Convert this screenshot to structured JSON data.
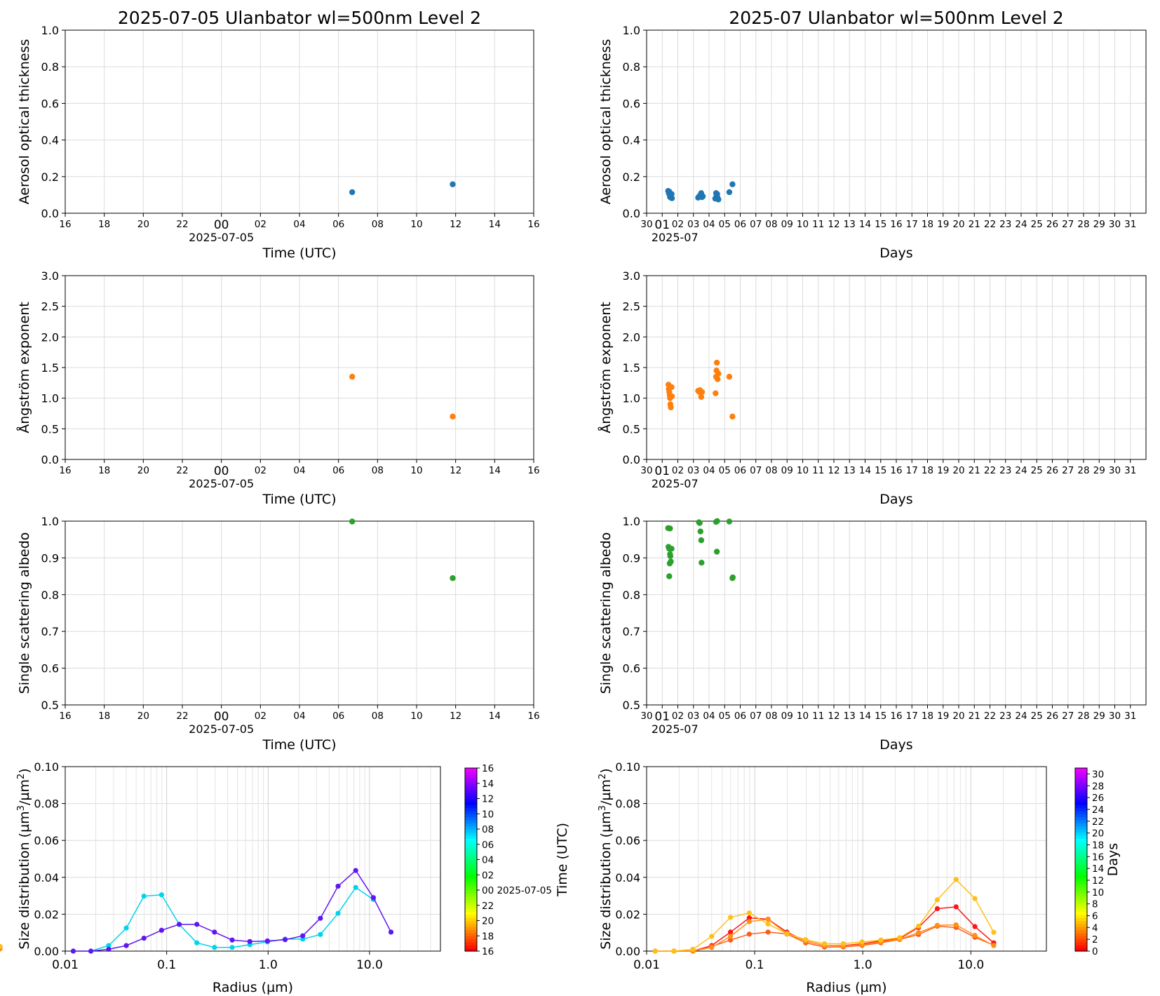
{
  "chart_data": [
    {
      "type": "scatter",
      "title": "2025-07-05  Ulanbator  wl=500nm  Level 2",
      "xlabel": "Time (UTC)",
      "ylabel": "Aerosol optical thickness",
      "date_label": "2025-07-05",
      "x_unit": "hours since 2025-07-05 00:00 UTC",
      "xlim": [
        -8,
        16
      ],
      "ylim": [
        0,
        1
      ],
      "x_ticks": [
        "16",
        "18",
        "20",
        "22",
        "00",
        "02",
        "04",
        "06",
        "08",
        "10",
        "12",
        "14",
        "16"
      ],
      "y_ticks": [
        "0.0",
        "0.2",
        "0.4",
        "0.6",
        "0.8",
        "1.0"
      ],
      "color": "#1f77b4",
      "points": [
        [
          6.7,
          0.115
        ],
        [
          11.85,
          0.158
        ]
      ]
    },
    {
      "type": "scatter",
      "title": "2025-07  Ulanbator  wl=500nm  Level 2",
      "xlabel": "Days",
      "ylabel": "Aerosol optical thickness",
      "date_label": "2025-07",
      "x_unit": "day of July 2025",
      "xlim": [
        0,
        32
      ],
      "ylim": [
        0,
        1
      ],
      "x_ticks": [
        "30",
        "01",
        "02",
        "03",
        "04",
        "05",
        "06",
        "07",
        "08",
        "09",
        "10",
        "11",
        "12",
        "13",
        "14",
        "15",
        "16",
        "17",
        "18",
        "19",
        "20",
        "21",
        "22",
        "23",
        "24",
        "25",
        "26",
        "27",
        "28",
        "29",
        "30",
        "31"
      ],
      "y_ticks": [
        "0.0",
        "0.2",
        "0.4",
        "0.6",
        "0.8",
        "1.0"
      ],
      "color": "#1f77b4",
      "points": [
        [
          1.38,
          0.122
        ],
        [
          1.42,
          0.11
        ],
        [
          1.45,
          0.118
        ],
        [
          1.48,
          0.098
        ],
        [
          1.5,
          0.088
        ],
        [
          1.52,
          0.1
        ],
        [
          1.55,
          0.092
        ],
        [
          1.58,
          0.085
        ],
        [
          1.6,
          0.105
        ],
        [
          1.62,
          0.082
        ],
        [
          3.3,
          0.085
        ],
        [
          3.35,
          0.09
        ],
        [
          3.4,
          0.095
        ],
        [
          3.45,
          0.1
        ],
        [
          3.5,
          0.11
        ],
        [
          3.55,
          0.088
        ],
        [
          3.6,
          0.092
        ],
        [
          4.4,
          0.08
        ],
        [
          4.45,
          0.11
        ],
        [
          4.48,
          0.095
        ],
        [
          4.52,
          0.105
        ],
        [
          4.55,
          0.085
        ],
        [
          4.6,
          0.075
        ],
        [
          5.3,
          0.115
        ],
        [
          5.5,
          0.158
        ]
      ]
    },
    {
      "type": "scatter",
      "xlabel": "Time (UTC)",
      "ylabel": "Ångström exponent",
      "date_label": "2025-07-05",
      "xlim": [
        -8,
        16
      ],
      "ylim": [
        0,
        3
      ],
      "x_ticks": [
        "16",
        "18",
        "20",
        "22",
        "00",
        "02",
        "04",
        "06",
        "08",
        "10",
        "12",
        "14",
        "16"
      ],
      "y_ticks": [
        "0.0",
        "0.5",
        "1.0",
        "1.5",
        "2.0",
        "2.5",
        "3.0"
      ],
      "color": "#ff7f0e",
      "points": [
        [
          6.7,
          1.35
        ],
        [
          11.85,
          0.7
        ]
      ]
    },
    {
      "type": "scatter",
      "xlabel": "Days",
      "ylabel": "Ångström exponent",
      "date_label": "2025-07",
      "xlim": [
        0,
        32
      ],
      "ylim": [
        0,
        3
      ],
      "x_ticks": [
        "30",
        "01",
        "02",
        "03",
        "04",
        "05",
        "06",
        "07",
        "08",
        "09",
        "10",
        "11",
        "12",
        "13",
        "14",
        "15",
        "16",
        "17",
        "18",
        "19",
        "20",
        "21",
        "22",
        "23",
        "24",
        "25",
        "26",
        "27",
        "28",
        "29",
        "30",
        "31"
      ],
      "y_ticks": [
        "0.0",
        "0.5",
        "1.0",
        "1.5",
        "2.0",
        "2.5",
        "3.0"
      ],
      "color": "#ff7f0e",
      "points": [
        [
          1.4,
          1.22
        ],
        [
          1.42,
          1.15
        ],
        [
          1.45,
          1.1
        ],
        [
          1.48,
          1.05
        ],
        [
          1.5,
          1.0
        ],
        [
          1.52,
          0.9
        ],
        [
          1.55,
          0.85
        ],
        [
          1.6,
          1.18
        ],
        [
          1.62,
          1.03
        ],
        [
          3.3,
          1.12
        ],
        [
          3.38,
          1.1
        ],
        [
          3.42,
          1.13
        ],
        [
          3.5,
          1.02
        ],
        [
          3.55,
          1.1
        ],
        [
          4.42,
          1.08
        ],
        [
          4.45,
          1.35
        ],
        [
          4.48,
          1.45
        ],
        [
          4.5,
          1.58
        ],
        [
          4.55,
          1.31
        ],
        [
          4.6,
          1.4
        ],
        [
          5.3,
          1.35
        ],
        [
          5.5,
          0.7
        ]
      ]
    },
    {
      "type": "scatter",
      "xlabel": "Time (UTC)",
      "ylabel": "Single scattering albedo",
      "date_label": "2025-07-05",
      "xlim": [
        -8,
        16
      ],
      "ylim": [
        0.5,
        1.0
      ],
      "x_ticks": [
        "16",
        "18",
        "20",
        "22",
        "00",
        "02",
        "04",
        "06",
        "08",
        "10",
        "12",
        "14",
        "16"
      ],
      "y_ticks": [
        "0.5",
        "0.6",
        "0.7",
        "0.8",
        "0.9",
        "1.0"
      ],
      "color": "#2ca02c",
      "points": [
        [
          6.7,
          0.999
        ],
        [
          11.85,
          0.845
        ]
      ]
    },
    {
      "type": "scatter",
      "xlabel": "Days",
      "ylabel": "Single scattering albedo",
      "date_label": "2025-07",
      "xlim": [
        0,
        32
      ],
      "ylim": [
        0.5,
        1.0
      ],
      "x_ticks": [
        "30",
        "01",
        "02",
        "03",
        "04",
        "05",
        "06",
        "07",
        "08",
        "09",
        "10",
        "11",
        "12",
        "13",
        "14",
        "15",
        "16",
        "17",
        "18",
        "19",
        "20",
        "21",
        "22",
        "23",
        "24",
        "25",
        "26",
        "27",
        "28",
        "29",
        "30",
        "31"
      ],
      "y_ticks": [
        "0.5",
        "0.6",
        "0.7",
        "0.8",
        "0.9",
        "1.0"
      ],
      "color": "#2ca02c",
      "points": [
        [
          1.38,
          0.981
        ],
        [
          1.5,
          0.98
        ],
        [
          1.4,
          0.93
        ],
        [
          1.45,
          0.925
        ],
        [
          1.5,
          0.91
        ],
        [
          1.52,
          0.905
        ],
        [
          1.48,
          0.885
        ],
        [
          1.55,
          0.89
        ],
        [
          1.45,
          0.85
        ],
        [
          1.6,
          0.925
        ],
        [
          3.35,
          0.997
        ],
        [
          3.4,
          0.995
        ],
        [
          3.45,
          0.972
        ],
        [
          3.5,
          0.948
        ],
        [
          3.52,
          0.887
        ],
        [
          4.45,
          0.998
        ],
        [
          4.52,
          1.0
        ],
        [
          4.5,
          0.917
        ],
        [
          5.3,
          0.999
        ],
        [
          5.5,
          0.845
        ],
        [
          5.52,
          0.847
        ]
      ]
    },
    {
      "type": "line",
      "xlabel": "Radius (µm)",
      "ylabel_main": "Size distribution (µm",
      "ylabel_sup1": "3",
      "ylabel_mid": "/µm",
      "ylabel_sup2": "2",
      "ylabel_end": ")",
      "xscale": "log",
      "xlim": [
        0.01,
        50
      ],
      "ylim": [
        0,
        0.1
      ],
      "x_ticks": [
        "0.01",
        "0.1",
        "1.0",
        "10.0"
      ],
      "y_ticks": [
        "0.00",
        "0.02",
        "0.04",
        "0.06",
        "0.08",
        "0.10"
      ],
      "radius": [
        0.012,
        0.0179,
        0.0268,
        0.04,
        0.0597,
        0.0891,
        0.133,
        0.1985,
        0.2963,
        0.4423,
        0.6603,
        0.9856,
        1.4713,
        2.1963,
        3.2785,
        4.8939,
        7.3053,
        10.9048,
        16.2778
      ],
      "series": [
        {
          "time_utc": 6.7,
          "color": "#00d4ec",
          "values": [
            0.0,
            0.0,
            0.003,
            0.0125,
            0.0298,
            0.0305,
            0.0145,
            0.0045,
            0.002,
            0.002,
            0.0035,
            0.005,
            0.0065,
            0.0065,
            0.009,
            0.0205,
            0.0345,
            0.028,
            null
          ]
        },
        {
          "time_utc": 11.85,
          "color": "#5f16f2",
          "values": [
            0.0,
            0.0,
            0.001,
            0.003,
            0.007,
            0.0113,
            0.0145,
            0.0145,
            0.0103,
            0.006,
            0.0052,
            0.0055,
            0.0062,
            0.0083,
            0.0178,
            0.0352,
            0.0437,
            0.029,
            0.0103,
            0.0025
          ]
        }
      ],
      "colorbar": {
        "label": "Time (UTC)",
        "ticks": [
          "16",
          "18",
          "20",
          "22",
          "00 2025-07-05",
          "02",
          "04",
          "06",
          "08",
          "10",
          "12",
          "14",
          "16"
        ],
        "range": [
          -8,
          16
        ]
      }
    },
    {
      "type": "line",
      "xlabel": "Radius (µm)",
      "ylabel_main": "Size distribution (µm",
      "ylabel_sup1": "3",
      "ylabel_mid": "/µm",
      "ylabel_sup2": "2",
      "ylabel_end": ")",
      "xscale": "log",
      "xlim": [
        0.01,
        50
      ],
      "ylim": [
        0,
        0.1
      ],
      "x_ticks": [
        "0.01",
        "0.1",
        "1.0",
        "10.0"
      ],
      "y_ticks": [
        "0.00",
        "0.02",
        "0.04",
        "0.06",
        "0.08",
        "0.10"
      ],
      "radius": [
        0.012,
        0.0179,
        0.0268,
        0.04,
        0.0597,
        0.0891,
        0.133,
        0.1985,
        0.2963,
        0.4423,
        0.6603,
        0.9856,
        1.4713,
        2.1963,
        3.2785,
        4.8939,
        7.3053,
        10.9048,
        16.2778
      ],
      "series": [
        {
          "day": 1,
          "color": "#ff1515",
          "values": [
            0.0,
            0.0,
            0.0,
            0.003,
            0.0103,
            0.018,
            0.0173,
            0.0103,
            0.0055,
            0.003,
            0.003,
            0.004,
            0.0055,
            0.0068,
            0.0128,
            0.023,
            0.024,
            0.0133,
            0.0045,
            0.002
          ]
        },
        {
          "day": 3,
          "color": "#ff5a17",
          "values": [
            0.0,
            0.0,
            0.0,
            0.0025,
            0.006,
            0.0092,
            0.0103,
            0.0093,
            0.0045,
            0.0022,
            0.0023,
            0.0031,
            0.0045,
            0.0063,
            0.009,
            0.0135,
            0.0128,
            0.0075,
            0.0032,
            0.0015
          ]
        },
        {
          "day": 4,
          "color": "#ff8f17",
          "values": [
            0.0,
            0.0,
            0.0,
            0.002,
            0.008,
            0.016,
            0.0172,
            0.0095,
            0.0055,
            0.003,
            0.0028,
            0.0035,
            0.005,
            0.0065,
            0.01,
            0.014,
            0.0142,
            0.0085,
            0.003,
            0.0012
          ]
        },
        {
          "day": 5,
          "color": "#ffbf17",
          "values": [
            0.0,
            0.0,
            0.001,
            0.008,
            0.0183,
            0.0207,
            0.0147,
            0.0095,
            0.0062,
            0.004,
            0.004,
            0.005,
            0.006,
            0.0073,
            0.0135,
            0.0278,
            0.0388,
            0.0285,
            0.0102,
            0.0025
          ]
        }
      ],
      "colorbar": {
        "label": "Days",
        "ticks": [
          "0",
          "2",
          "4",
          "6",
          "8",
          "10",
          "12",
          "14",
          "16",
          "18",
          "20",
          "22",
          "24",
          "26",
          "28",
          "30"
        ],
        "range": [
          0,
          31
        ]
      }
    }
  ]
}
